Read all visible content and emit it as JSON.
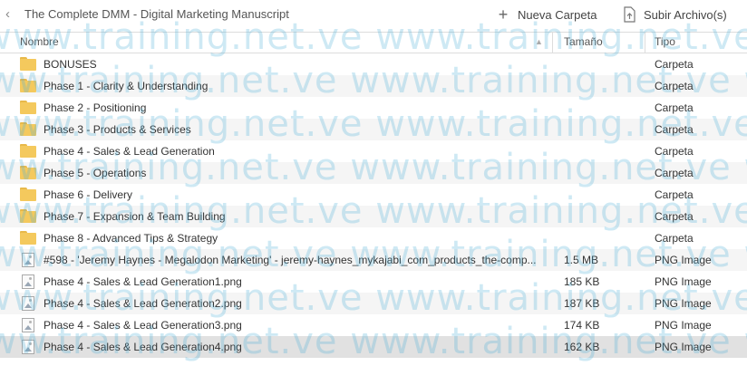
{
  "toolbar": {
    "breadcrumb": "The Complete DMM - Digital Marketing Manuscript",
    "new_folder": "Nueva Carpeta",
    "upload": "Subir Archivo(s)"
  },
  "columns": {
    "name": "Nombre",
    "size": "Tamaño",
    "type": "Tipo"
  },
  "files": [
    {
      "name": "BONUSES",
      "size": "",
      "type": "Carpeta",
      "kind": "folder"
    },
    {
      "name": "Phase 1 - Clarity & Understanding",
      "size": "",
      "type": "Carpeta",
      "kind": "folder"
    },
    {
      "name": "Phase 2 - Positioning",
      "size": "",
      "type": "Carpeta",
      "kind": "folder"
    },
    {
      "name": "Phase 3 - Products & Services",
      "size": "",
      "type": "Carpeta",
      "kind": "folder"
    },
    {
      "name": "Phase 4 - Sales & Lead Generation",
      "size": "",
      "type": "Carpeta",
      "kind": "folder"
    },
    {
      "name": "Phase 5 - Operations",
      "size": "",
      "type": "Carpeta",
      "kind": "folder"
    },
    {
      "name": "Phase 6 - Delivery",
      "size": "",
      "type": "Carpeta",
      "kind": "folder"
    },
    {
      "name": "Phase 7 - Expansion & Team Building",
      "size": "",
      "type": "Carpeta",
      "kind": "folder"
    },
    {
      "name": "Phase 8 - Advanced Tips & Strategy",
      "size": "",
      "type": "Carpeta",
      "kind": "folder"
    },
    {
      "name": "#598 - 'Jeremy Haynes - Megalodon Marketing' - jeremy-haynes_mykajabi_com_products_the-comp...",
      "size": "1.5 MB",
      "type": "PNG Image",
      "kind": "image"
    },
    {
      "name": "Phase 4 - Sales & Lead Generation1.png",
      "size": "185 KB",
      "type": "PNG Image",
      "kind": "image"
    },
    {
      "name": "Phase 4 - Sales & Lead Generation2.png",
      "size": "187 KB",
      "type": "PNG Image",
      "kind": "image"
    },
    {
      "name": "Phase 4 - Sales & Lead Generation3.png",
      "size": "174 KB",
      "type": "PNG Image",
      "kind": "image"
    },
    {
      "name": "Phase 4 - Sales & Lead Generation4.png",
      "size": "162 KB",
      "type": "PNG Image",
      "kind": "image",
      "selected": true
    }
  ],
  "watermark": "www.training.net.ve"
}
